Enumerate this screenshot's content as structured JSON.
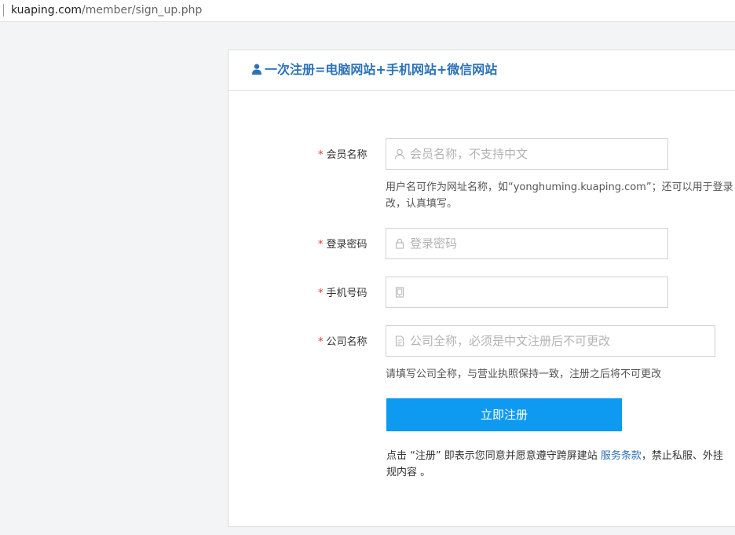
{
  "browser": {
    "url_domain": "kuaping.com",
    "url_path": "/member/sign_up.php"
  },
  "header": {
    "title": "一次注册=电脑网站+手机网站+微信网站"
  },
  "form": {
    "required_mark": "*",
    "username": {
      "label": "会员名称",
      "placeholder": "会员名称，不支持中文",
      "value": "",
      "hint_line1": "用户名可作为网址名称，如“yonghuming.kuaping.com”；还可以用于登录",
      "hint_line2": "改，认真填写。"
    },
    "password": {
      "label": "登录密码",
      "placeholder": "登录密码",
      "value": ""
    },
    "phone": {
      "label": "手机号码",
      "placeholder": "",
      "value": ""
    },
    "company": {
      "label": "公司名称",
      "placeholder": "公司全称，必须是中文注册后不可更改",
      "value": "",
      "hint": "请填写公司全称，与营业执照保持一致，注册之后将不可更改"
    },
    "submit_label": "立即注册",
    "terms": {
      "prefix": "点击 “注册” 即表示您同意并愿意遵守跨屏建站 ",
      "link": "服务条款",
      "suffix": "，禁止私服、外挂",
      "line2": "规内容 。"
    }
  },
  "colors": {
    "accent": "#0e9af0",
    "title": "#2c72b8",
    "required": "#e33333"
  }
}
